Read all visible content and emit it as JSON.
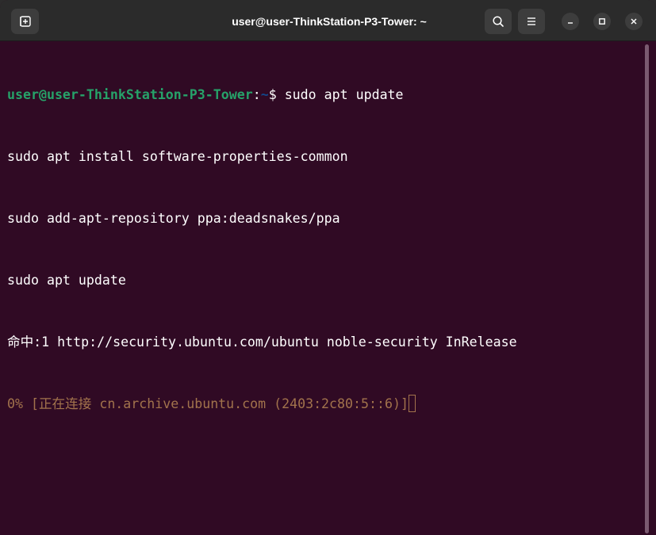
{
  "window": {
    "title": "user@user-ThinkStation-P3-Tower: ~"
  },
  "titlebar": {
    "new_tab_icon": "new-tab-icon",
    "search_icon": "search-icon",
    "menu_icon": "hamburger-menu-icon",
    "minimize_icon": "minimize-icon",
    "maximize_icon": "maximize-icon",
    "close_icon": "close-icon"
  },
  "terminal": {
    "prompt": {
      "user_host": "user@user-ThinkStation-P3-Tower",
      "separator": ":",
      "path": "~",
      "symbol": "$ ",
      "command": "sudo apt update"
    },
    "lines": [
      "sudo apt install software-properties-common",
      "sudo add-apt-repository ppa:deadsnakes/ppa",
      "sudo apt update",
      "命中:1 http://security.ubuntu.com/ubuntu noble-security InRelease"
    ],
    "progress_line": "0% [正在连接 cn.archive.ubuntu.com (2403:2c80:5::6)]"
  },
  "colors": {
    "background": "#300a24",
    "prompt_user": "#26a269",
    "prompt_path": "#12488b",
    "progress_text": "#a2734c",
    "titlebar": "#2b2b2b"
  }
}
